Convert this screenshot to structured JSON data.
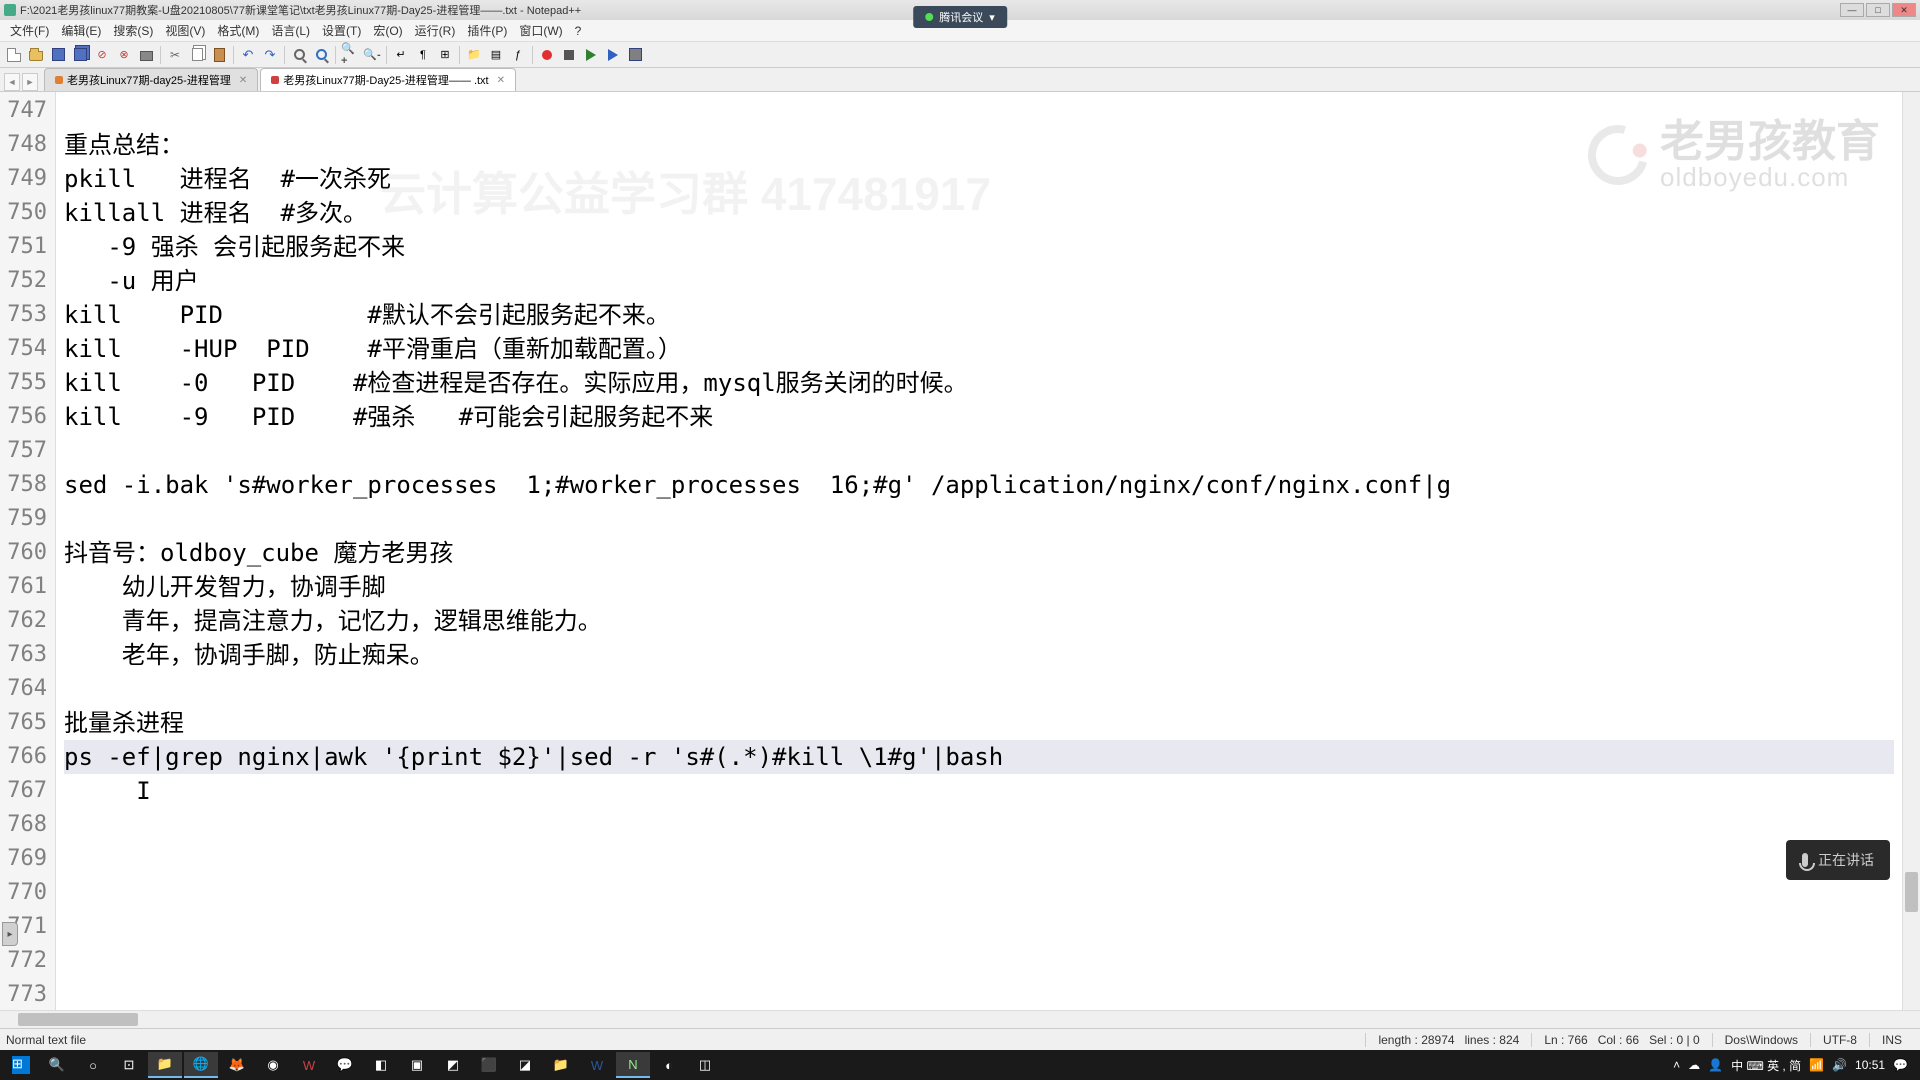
{
  "window": {
    "title": "F:\\2021老男孩linux77期教案-U盘20210805\\77新课堂笔记\\txt老男孩Linux77期-Day25-进程管理——.txt - Notepad++",
    "floating_label": "腾讯会议"
  },
  "menus": [
    "文件(F)",
    "编辑(E)",
    "搜索(S)",
    "视图(V)",
    "格式(M)",
    "语言(L)",
    "设置(T)",
    "宏(O)",
    "运行(R)",
    "插件(P)",
    "窗口(W)",
    "?"
  ],
  "tabs": [
    {
      "label": "老男孩Linux77期-day25-进程管理",
      "active": false
    },
    {
      "label": "老男孩Linux77期-Day25-进程管理—— .txt",
      "active": true
    }
  ],
  "lines": {
    "start": 747,
    "content": [
      "",
      "重点总结：",
      "pkill   进程名  #一次杀死",
      "killall 进程名  #多次。",
      "   -9 强杀 会引起服务起不来",
      "   -u 用户",
      "kill    PID          #默认不会引起服务起不来。",
      "kill    -HUP  PID    #平滑重启（重新加载配置。）",
      "kill    -0   PID    #检查进程是否存在。实际应用，mysql服务关闭的时候。",
      "kill    -9   PID    #强杀   #可能会引起服务起不来",
      "",
      "sed -i.bak 's#worker_processes  1;#worker_processes  16;#g' /application/nginx/conf/nginx.conf|g",
      "",
      "抖音号：oldboy_cube 魔方老男孩",
      "    幼儿开发智力，协调手脚",
      "    青年，提高注意力，记忆力，逻辑思维能力。",
      "    老年，协调手脚，防止痴呆。",
      "",
      "批量杀进程",
      "ps -ef|grep nginx|awk '{print $2}'|sed -r 's#(.*)#kill \\1#g'|bash",
      "     I",
      "",
      "",
      "",
      "",
      "",
      ""
    ],
    "highlight_index": 19
  },
  "watermark": {
    "cn": "老男孩教育",
    "url": "oldboyedu.com",
    "bg_text": "云计算公益学习群 417481917"
  },
  "popup": {
    "text": "正在讲话"
  },
  "status": {
    "filetype": "Normal text file",
    "length_label": "length :",
    "length": "28974",
    "lines_label": "lines :",
    "lines": "824",
    "ln_label": "Ln :",
    "ln": "766",
    "col_label": "Col :",
    "col": "66",
    "sel_label": "Sel :",
    "sel": "0 | 0",
    "eol": "Dos\\Windows",
    "enc": "UTF-8",
    "mode": "INS"
  },
  "taskbar": {
    "time": "10:51",
    "ime": "中 ⌨ 英 , 简"
  }
}
